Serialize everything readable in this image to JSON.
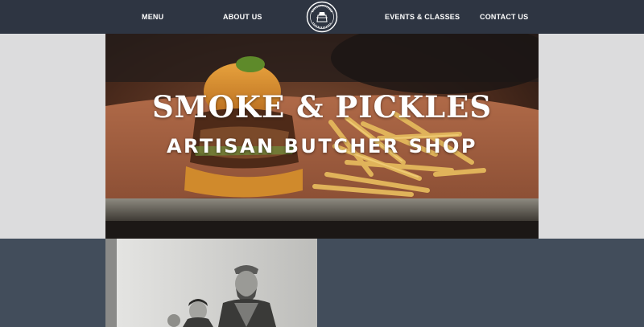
{
  "nav": {
    "menu_label": "MENU",
    "about_label": "ABOUT US",
    "events_label": "EVENTS & CLASSES",
    "contact_label": "CONTACT US"
  },
  "logo": {
    "icon": "butcher-shop-seal-logo"
  },
  "hero": {
    "title": "SMOKE & PICKLES",
    "subtitle": "ARTISAN BUTCHER SHOP",
    "image": "burger-and-fries-photo"
  },
  "team_photo": {
    "image": "butchers-black-and-white-photo"
  },
  "colors": {
    "header_bg": "#2e3542",
    "page_bg": "#dcdcdd",
    "lower_bg": "#424d5b",
    "text": "#ffffff"
  }
}
